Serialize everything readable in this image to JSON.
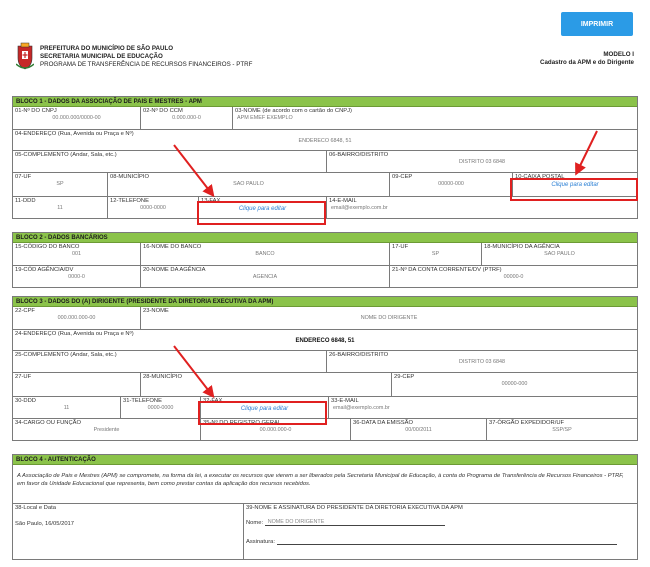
{
  "actions": {
    "print_label": "IMPRIMIR"
  },
  "header": {
    "line1": "PREFEITURA DO MUNICÍPIO DE SÃO PAULO",
    "line2": "SECRETARIA MUNICIPAL DE EDUCAÇÃO",
    "line3": "PROGRAMA DE TRANSFERÊNCIA DE RECURSOS FINANCEIROS - PTRF",
    "model": "MODELO I",
    "subtitle": "Cadastro da APM e do Dirigente"
  },
  "colors": {
    "header_bar": "#8bc34a",
    "print_button": "#2b9be6",
    "highlight": "#e02020",
    "edit_link": "#2a7fd4"
  },
  "edit_label": "Clique para editar",
  "bloco1": {
    "title": "BLOCO 1 - DADOS DA ASSOCIAÇÃO DE PAIS E MESTRES - APM",
    "cnpj_label": "01-Nº DO CNPJ",
    "cnpj_value": "00.000.000/0000-00",
    "ccm_label": "02-Nº DO CCM",
    "ccm_value": "0.000.000-0",
    "nome_label": "03-NOME (de acordo com o cartão do CNPJ)",
    "nome_value": "APM EMEF EXEMPLO",
    "endereco_label": "04-ENDEREÇO (Rua, Avenida ou Praça e Nº)",
    "endereco_value": "ENDERECO 6848, 51",
    "complemento_label": "05-COMPLEMENTO (Andar, Sala, etc.)",
    "bairro_label": "06-BAIRRO/DISTRITO",
    "bairro_value": "DISTRITO 03 6848",
    "uf_label": "07-UF",
    "uf_value": "SP",
    "municipio_label": "08-MUNICÍPIO",
    "municipio_value": "SAO PAULO",
    "cep_label": "09-CEP",
    "cep_value": "00000-000",
    "caixa_label": "10-CAIXA POSTAL",
    "ddd_label": "11-DDD",
    "ddd_value": "11",
    "telefone_label": "12-TELEFONE",
    "telefone_value": "0000-0000",
    "fax_label": "13-FAX",
    "email_label": "14-E-MAIL",
    "email_value": "email@exemplo.com.br"
  },
  "bloco2": {
    "title": "BLOCO 2 - DADOS BANCÁRIOS",
    "codbanco_label": "15-CÓDIGO DO BANCO",
    "codbanco_value": "001",
    "nomebanco_label": "16-NOME DO BANCO",
    "nomebanco_value": "BANCO",
    "uf_label": "17-UF",
    "uf_value": "SP",
    "municipio_label": "18-MUNICÍPIO DA AGÊNCIA",
    "municipio_value": "SAO PAULO",
    "codagencia_label": "19-CÓD AGÊNCIA/DV",
    "codagencia_value": "0000-0",
    "nomeagencia_label": "20-NOME DA AGÊNCIA",
    "nomeagencia_value": "AGENCIA",
    "conta_label": "21-Nº DA CONTA CORRENTE/DV (PTRF)",
    "conta_value": "00000-0"
  },
  "bloco3": {
    "title": "BLOCO 3 - DADOS DO (A) DIRIGENTE (PRESIDENTE DA DIRETORIA EXECUTIVA DA APM)",
    "cpf_label": "22-CPF",
    "cpf_value": "000.000.000-00",
    "nome_label": "23-NOME",
    "nome_value": "NOME DO DIRIGENTE",
    "endereco_label": "24-ENDEREÇO (Rua, Avenida ou Praça e Nº)",
    "endereco_value": "ENDERECO 6848, 51",
    "complemento_label": "25-COMPLEMENTO (Andar, Sala, etc.)",
    "bairro_label": "26-BAIRRO/DISTRITO",
    "bairro_value": "DISTRITO 03 6848",
    "uf_label": "27-UF",
    "municipio_label": "28-MUNICÍPIO",
    "cep_label": "29-CEP",
    "cep_value": "00000-000",
    "ddd_label": "30-DDD",
    "ddd_value": "11",
    "telefone_label": "31-TELEFONE",
    "telefone_value": "0000-0000",
    "fax_label": "32-FAX",
    "email_label": "33-E-MAIL",
    "email_value": "email@exemplo.com.br",
    "cargo_label": "34-CARGO OU FUNÇÃO",
    "cargo_value": "Presidente",
    "rg_label": "35-Nº DO REGISTRO GERAL",
    "rg_value": "00.000.000-0",
    "emissao_label": "36-DATA DA EMISSÃO",
    "emissao_value": "00/00/2011",
    "orgao_label": "37-ÓRGÃO EXPEDIDOR/UF",
    "orgao_value": "SSP/SP"
  },
  "bloco4": {
    "title": "BLOCO 4 - AUTENTICAÇÃO",
    "text": "A Associação de Pais e Mestres (APM) se compromete, na forma da lei, a executar os recursos que vierem a ser liberados pela Secretaria Municipal de Educação, à conta do Programa de Transferência de Recursos Financeiros - PTRF, em favor da Unidade Educacional que representa, bem como prestar contas da aplicação dos recursos recebidos.",
    "local_label": "38-Local e Data",
    "local_value": "São Paulo, 16/05/2017",
    "assinatura_label": "39-NOME E ASSINATURA DO PRESIDENTE DA DIRETORIA EXECUTIVA DA APM",
    "nome_label": "Nome:",
    "nome_value": "NOME DO DIRIGENTE",
    "assin_label": "Assinatura:"
  }
}
